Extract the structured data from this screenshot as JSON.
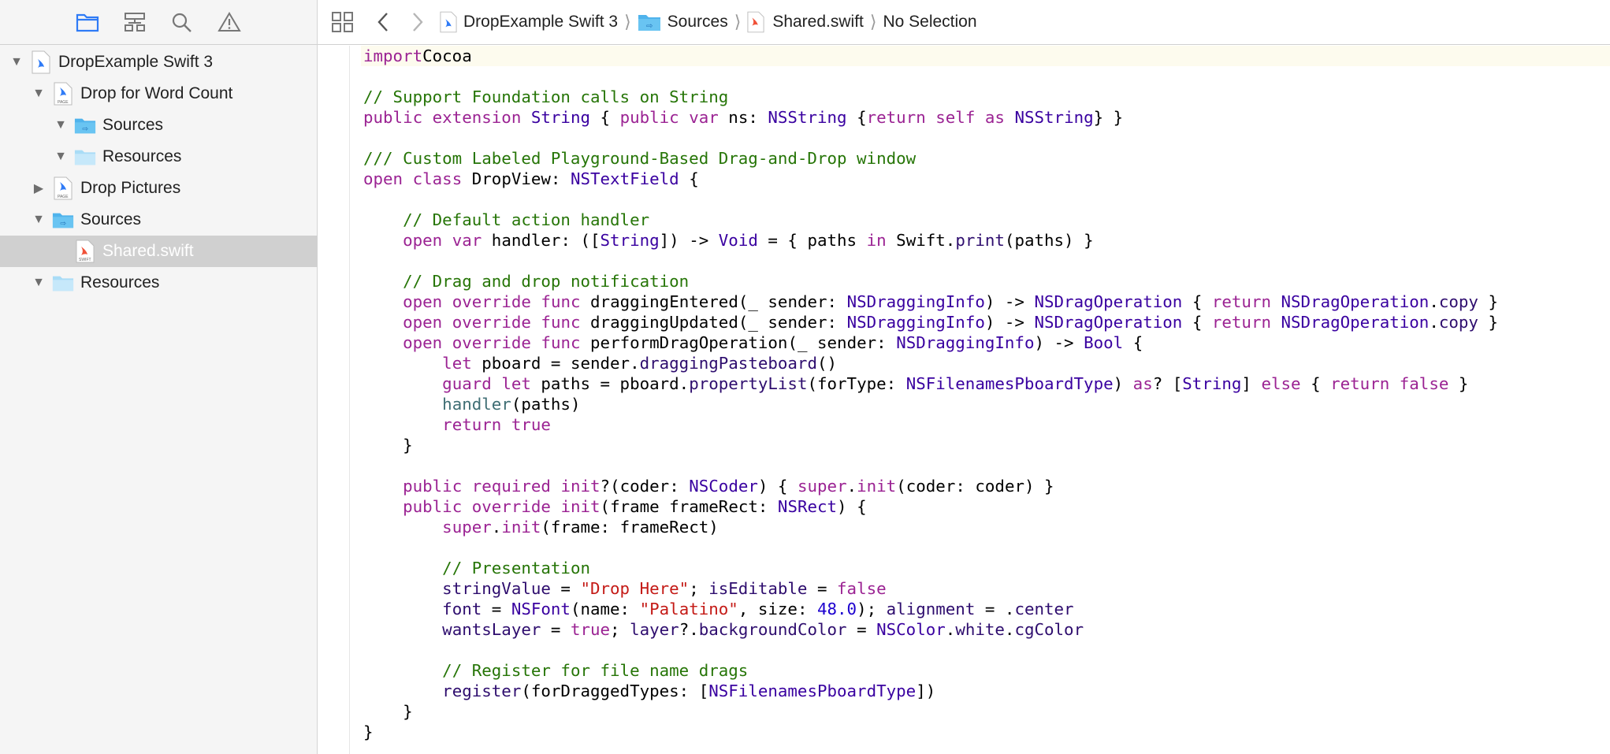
{
  "sidebar": {
    "toolbar_icons": [
      "folder-icon",
      "hierarchy-icon",
      "magnifier-icon",
      "warning-icon"
    ],
    "tree": [
      {
        "label": "DropExample Swift 3",
        "expanded": true,
        "icon": "playground-file-icon"
      },
      {
        "label": "Drop for Word Count",
        "expanded": true,
        "icon": "playground-page-icon"
      },
      {
        "label": "Sources",
        "expanded": true,
        "icon": "folder-icon"
      },
      {
        "label": "Resources",
        "expanded": true,
        "icon": "folder-icon"
      },
      {
        "label": "Drop Pictures",
        "expanded": false,
        "icon": "playground-page-icon"
      },
      {
        "label": "Sources",
        "expanded": true,
        "icon": "folder-icon"
      },
      {
        "label": "Shared.swift",
        "selected": true,
        "icon": "swift-file-icon"
      },
      {
        "label": "Resources",
        "expanded": true,
        "icon": "folder-icon"
      }
    ]
  },
  "jumpbar": {
    "crumbs": [
      {
        "label": "DropExample Swift 3",
        "icon": "playground-file-icon"
      },
      {
        "label": "Sources",
        "icon": "folder-icon"
      },
      {
        "label": "Shared.swift",
        "icon": "swift-file-icon"
      },
      {
        "label": "No Selection"
      }
    ]
  },
  "code_lines": [
    [
      [
        "kw",
        "import"
      ],
      [
        "",
        "Cocoa"
      ]
    ],
    [],
    [
      [
        "cm",
        "// Support Foundation calls on String"
      ]
    ],
    [
      [
        "kw",
        "public"
      ],
      [
        "",
        " "
      ],
      [
        "kw",
        "extension"
      ],
      [
        "",
        " "
      ],
      [
        "ty",
        "String"
      ],
      [
        "",
        " { "
      ],
      [
        "kw",
        "public"
      ],
      [
        "",
        " "
      ],
      [
        "kw",
        "var"
      ],
      [
        "",
        " ns: "
      ],
      [
        "ty",
        "NSString"
      ],
      [
        "",
        " {"
      ],
      [
        "kw",
        "return"
      ],
      [
        "",
        " "
      ],
      [
        "kw",
        "self"
      ],
      [
        "",
        " "
      ],
      [
        "kw",
        "as"
      ],
      [
        "",
        " "
      ],
      [
        "ty",
        "NSString"
      ],
      [
        "",
        "} }"
      ]
    ],
    [],
    [
      [
        "cm",
        "/// Custom Labeled Playground-Based Drag-and-Drop window"
      ]
    ],
    [
      [
        "kw",
        "open"
      ],
      [
        "",
        " "
      ],
      [
        "kw",
        "class"
      ],
      [
        "",
        " DropView: "
      ],
      [
        "ty",
        "NSTextField"
      ],
      [
        "",
        " {"
      ]
    ],
    [],
    [
      [
        "",
        "    "
      ],
      [
        "cm",
        "// Default action handler"
      ]
    ],
    [
      [
        "",
        "    "
      ],
      [
        "kw",
        "open"
      ],
      [
        "",
        " "
      ],
      [
        "kw",
        "var"
      ],
      [
        "",
        " handler: (["
      ],
      [
        "ty",
        "String"
      ],
      [
        "",
        "]) -> "
      ],
      [
        "ty",
        "Void"
      ],
      [
        "",
        " = { paths "
      ],
      [
        "kw",
        "in"
      ],
      [
        "",
        " Swift."
      ],
      [
        "fn",
        "print"
      ],
      [
        "",
        "(paths) }"
      ]
    ],
    [],
    [
      [
        "",
        "    "
      ],
      [
        "cm",
        "// Drag and drop notification"
      ]
    ],
    [
      [
        "",
        "    "
      ],
      [
        "kw",
        "open"
      ],
      [
        "",
        " "
      ],
      [
        "kw",
        "override"
      ],
      [
        "",
        " "
      ],
      [
        "kw",
        "func"
      ],
      [
        "",
        " draggingEntered(_ sender: "
      ],
      [
        "ty",
        "NSDraggingInfo"
      ],
      [
        "",
        ") -> "
      ],
      [
        "ty",
        "NSDragOperation"
      ],
      [
        "",
        " { "
      ],
      [
        "kw",
        "return"
      ],
      [
        "",
        " "
      ],
      [
        "ty",
        "NSDragOperation"
      ],
      [
        "",
        "."
      ],
      [
        "fn",
        "copy"
      ],
      [
        "",
        " }"
      ]
    ],
    [
      [
        "",
        "    "
      ],
      [
        "kw",
        "open"
      ],
      [
        "",
        " "
      ],
      [
        "kw",
        "override"
      ],
      [
        "",
        " "
      ],
      [
        "kw",
        "func"
      ],
      [
        "",
        " draggingUpdated(_ sender: "
      ],
      [
        "ty",
        "NSDraggingInfo"
      ],
      [
        "",
        ") -> "
      ],
      [
        "ty",
        "NSDragOperation"
      ],
      [
        "",
        " { "
      ],
      [
        "kw",
        "return"
      ],
      [
        "",
        " "
      ],
      [
        "ty",
        "NSDragOperation"
      ],
      [
        "",
        "."
      ],
      [
        "fn",
        "copy"
      ],
      [
        "",
        " }"
      ]
    ],
    [
      [
        "",
        "    "
      ],
      [
        "kw",
        "open"
      ],
      [
        "",
        " "
      ],
      [
        "kw",
        "override"
      ],
      [
        "",
        " "
      ],
      [
        "kw",
        "func"
      ],
      [
        "",
        " performDragOperation(_ sender: "
      ],
      [
        "ty",
        "NSDraggingInfo"
      ],
      [
        "",
        ") -> "
      ],
      [
        "ty",
        "Bool"
      ],
      [
        "",
        " {"
      ]
    ],
    [
      [
        "",
        "        "
      ],
      [
        "kw",
        "let"
      ],
      [
        "",
        " pboard = sender."
      ],
      [
        "fn",
        "draggingPasteboard"
      ],
      [
        "",
        "()"
      ]
    ],
    [
      [
        "",
        "        "
      ],
      [
        "kw",
        "guard"
      ],
      [
        "",
        " "
      ],
      [
        "kw",
        "let"
      ],
      [
        "",
        " paths = pboard."
      ],
      [
        "fn",
        "propertyList"
      ],
      [
        "",
        "(forType: "
      ],
      [
        "ty",
        "NSFilenamesPboardType"
      ],
      [
        "",
        ") "
      ],
      [
        "kw",
        "as"
      ],
      [
        "",
        "? ["
      ],
      [
        "ty",
        "String"
      ],
      [
        "",
        "] "
      ],
      [
        "kw",
        "else"
      ],
      [
        "",
        " { "
      ],
      [
        "kw",
        "return"
      ],
      [
        "",
        " "
      ],
      [
        "kw",
        "false"
      ],
      [
        "",
        " }"
      ]
    ],
    [
      [
        "",
        "        "
      ],
      [
        "mk",
        "handler"
      ],
      [
        "",
        "(paths)"
      ]
    ],
    [
      [
        "",
        "        "
      ],
      [
        "kw",
        "return"
      ],
      [
        "",
        " "
      ],
      [
        "kw",
        "true"
      ]
    ],
    [
      [
        "",
        "    }"
      ]
    ],
    [],
    [
      [
        "",
        "    "
      ],
      [
        "kw",
        "public"
      ],
      [
        "",
        " "
      ],
      [
        "kw",
        "required"
      ],
      [
        "",
        " "
      ],
      [
        "kw",
        "init"
      ],
      [
        "",
        "?(coder: "
      ],
      [
        "ty",
        "NSCoder"
      ],
      [
        "",
        ") { "
      ],
      [
        "kw",
        "super"
      ],
      [
        "",
        "."
      ],
      [
        "kw",
        "init"
      ],
      [
        "",
        "(coder: coder) }"
      ]
    ],
    [
      [
        "",
        "    "
      ],
      [
        "kw",
        "public"
      ],
      [
        "",
        " "
      ],
      [
        "kw",
        "override"
      ],
      [
        "",
        " "
      ],
      [
        "kw",
        "init"
      ],
      [
        "",
        "(frame frameRect: "
      ],
      [
        "ty",
        "NSRect"
      ],
      [
        "",
        ") {"
      ]
    ],
    [
      [
        "",
        "        "
      ],
      [
        "kw",
        "super"
      ],
      [
        "",
        "."
      ],
      [
        "kw",
        "init"
      ],
      [
        "",
        "(frame: frameRect)"
      ]
    ],
    [],
    [
      [
        "",
        "        "
      ],
      [
        "cm",
        "// Presentation"
      ]
    ],
    [
      [
        "",
        "        "
      ],
      [
        "fn",
        "stringValue"
      ],
      [
        "",
        " = "
      ],
      [
        "st",
        "\"Drop Here\""
      ],
      [
        "",
        "; "
      ],
      [
        "fn",
        "isEditable"
      ],
      [
        "",
        " = "
      ],
      [
        "kw",
        "false"
      ]
    ],
    [
      [
        "",
        "        "
      ],
      [
        "fn",
        "font"
      ],
      [
        "",
        " = "
      ],
      [
        "ty",
        "NSFont"
      ],
      [
        "",
        "(name: "
      ],
      [
        "st",
        "\"Palatino\""
      ],
      [
        "",
        ", size: "
      ],
      [
        "nm",
        "48.0"
      ],
      [
        "",
        "); "
      ],
      [
        "fn",
        "alignment"
      ],
      [
        "",
        " = ."
      ],
      [
        "fn",
        "center"
      ]
    ],
    [
      [
        "",
        "        "
      ],
      [
        "fn",
        "wantsLayer"
      ],
      [
        "",
        " = "
      ],
      [
        "kw",
        "true"
      ],
      [
        "",
        "; "
      ],
      [
        "fn",
        "layer"
      ],
      [
        "",
        "?."
      ],
      [
        "fn",
        "backgroundColor"
      ],
      [
        "",
        " = "
      ],
      [
        "ty",
        "NSColor"
      ],
      [
        "",
        "."
      ],
      [
        "fn",
        "white"
      ],
      [
        "",
        "."
      ],
      [
        "fn",
        "cgColor"
      ]
    ],
    [],
    [
      [
        "",
        "        "
      ],
      [
        "cm",
        "// Register for file name drags"
      ]
    ],
    [
      [
        "",
        "        "
      ],
      [
        "fn",
        "register"
      ],
      [
        "",
        "(forDraggedTypes: ["
      ],
      [
        "ty",
        "NSFilenamesPboardType"
      ],
      [
        "",
        "])"
      ]
    ],
    [
      [
        "",
        "    }"
      ]
    ],
    [
      [
        "",
        "}"
      ]
    ]
  ],
  "colors": {
    "keyword": "#9b2393",
    "type": "#3900a0",
    "comment": "#267507",
    "string": "#c41a16",
    "number": "#1c00cf",
    "sidebar_bg": "#f5f5f5",
    "selection_bg": "#d0d0d0",
    "folder_blue": "#4fb3ec"
  }
}
